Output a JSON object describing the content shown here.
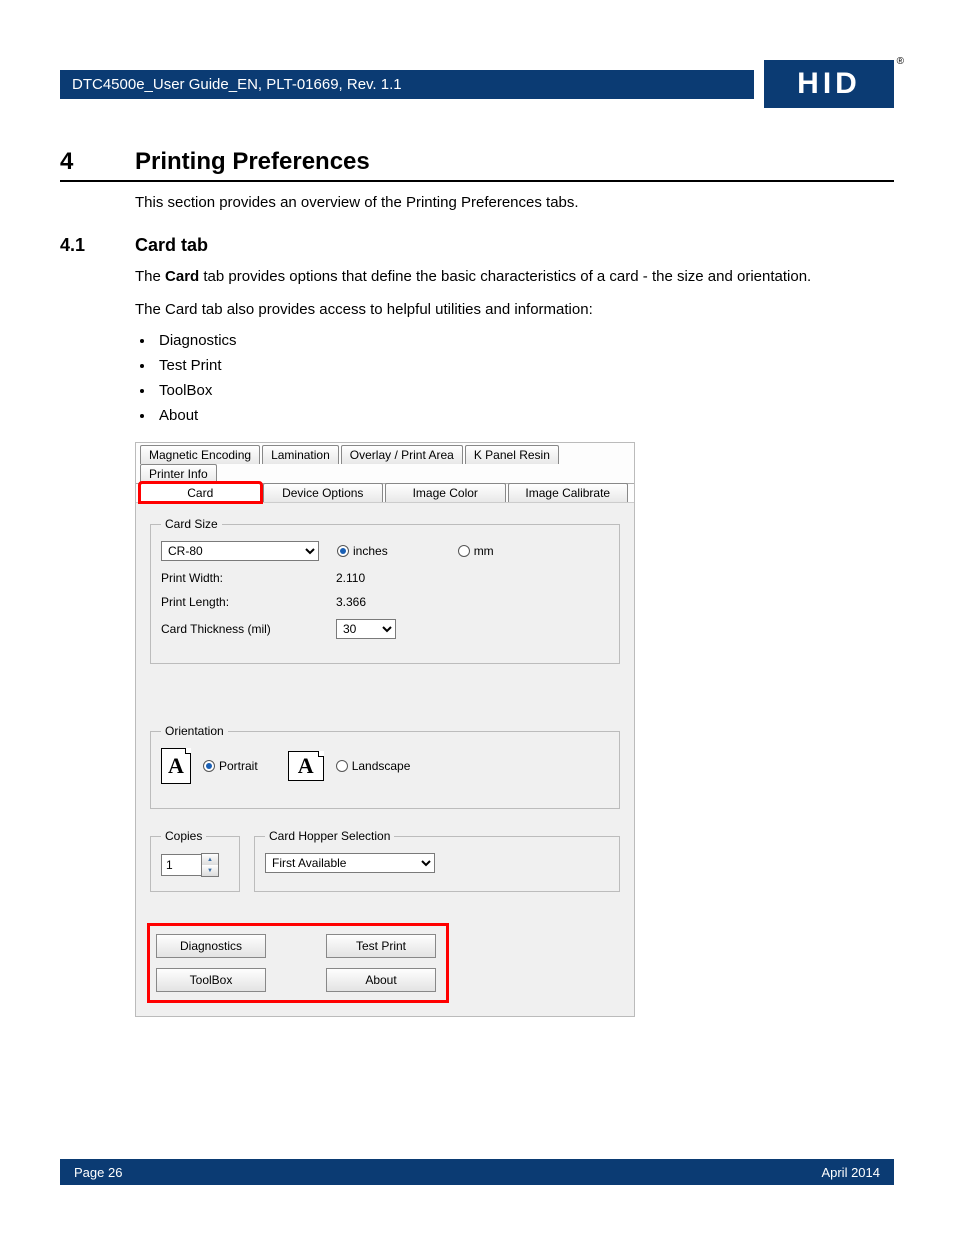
{
  "header": {
    "doc_title": "DTC4500e_User Guide_EN, PLT-01669, Rev. 1.1",
    "logo_text": "HID",
    "reg": "®"
  },
  "section": {
    "num": "4",
    "title": "Printing Preferences",
    "intro": "This section provides an overview of the Printing Preferences tabs."
  },
  "subsection": {
    "num": "4.1",
    "title": "Card tab",
    "p1_pre": "The ",
    "p1_bold": "Card",
    "p1_post": " tab provides options that define the basic characteristics of a card - the size and orientation.",
    "p2": "The Card tab also provides access to helpful utilities and information:",
    "bullets": [
      "Diagnostics",
      "Test Print",
      "ToolBox",
      "About"
    ]
  },
  "dialog": {
    "tabs_back": [
      "Magnetic Encoding",
      "Lamination",
      "Overlay / Print Area",
      "K Panel Resin",
      "Printer Info"
    ],
    "tabs_front": [
      "Card",
      "Device Options",
      "Image Color",
      "Image Calibrate"
    ],
    "card_size": {
      "legend": "Card Size",
      "select_value": "CR-80",
      "radio_inches": "inches",
      "radio_mm": "mm",
      "print_width_label": "Print Width:",
      "print_width_value": "2.110",
      "print_length_label": "Print Length:",
      "print_length_value": "3.366",
      "thickness_label": "Card Thickness (mil)",
      "thickness_value": "30"
    },
    "orientation": {
      "legend": "Orientation",
      "portrait": "Portrait",
      "landscape": "Landscape"
    },
    "copies": {
      "legend": "Copies",
      "value": "1"
    },
    "hopper": {
      "legend": "Card Hopper Selection",
      "value": "First Available"
    },
    "buttons": {
      "diagnostics": "Diagnostics",
      "test_print": "Test Print",
      "toolbox": "ToolBox",
      "about": "About"
    }
  },
  "footer": {
    "page": "Page 26",
    "date": "April 2014"
  }
}
